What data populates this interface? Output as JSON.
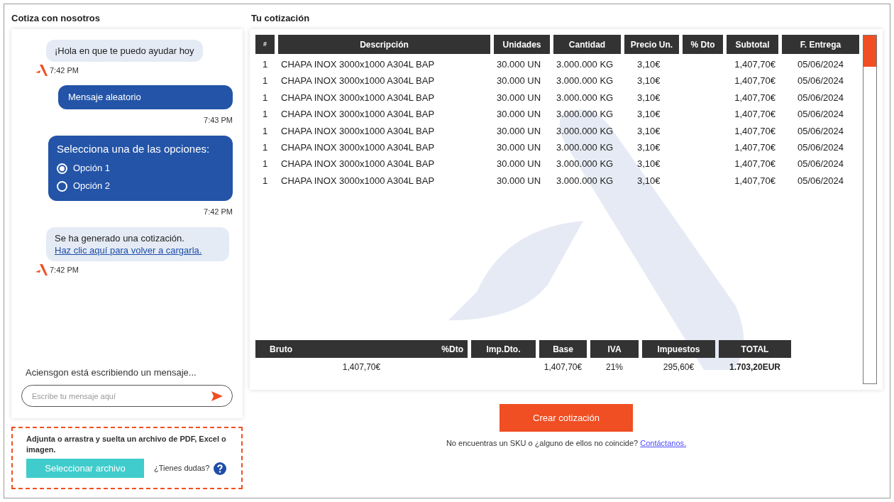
{
  "chat": {
    "title": "Cotiza con nosotros",
    "messages": [
      {
        "kind": "bot",
        "text": "¡Hola en que te puedo ayudar hoy",
        "time": "7:42 PM"
      },
      {
        "kind": "user",
        "text": "Mensaje aleatorio",
        "time": "7:43 PM"
      },
      {
        "kind": "options",
        "text": "Selecciona una de las opciones:",
        "time": "7:42 PM",
        "options": [
          {
            "label": "Opción 1",
            "selected": true
          },
          {
            "label": "Opción 2",
            "selected": false
          }
        ]
      },
      {
        "kind": "bot",
        "text": "Se ha generado una cotización.",
        "link": "Haz clic aquí para volver a cargarla.",
        "time": "7:42 PM"
      }
    ],
    "typing": "Aciensgon está escribiendo un mensaje...",
    "input": {
      "placeholder": "Escribe tu mensaje aquí"
    }
  },
  "upload": {
    "text": "Adjunta o arrastra y suelta un archivo de PDF, Excel  o imagen.",
    "button": "Seleccionar archivo",
    "help": "¿Tienes dudas?"
  },
  "quote": {
    "title": "Tu cotización",
    "columns": [
      "#",
      "Descripción",
      "Unidades",
      "Cantidad",
      "Precio Un.",
      "% Dto",
      "Subtotal",
      "F. Entrega"
    ],
    "rows": [
      {
        "num": "1",
        "description": "CHAPA INOX 3000x1000 A304L BAP",
        "units": "30.000 UN",
        "quantity": "3.000.000 KG",
        "price": "3,10€",
        "subtotal": "1,407,70€",
        "delivery": "05/06/2024"
      },
      {
        "num": "1",
        "description": "CHAPA INOX 3000x1000 A304L BAP",
        "units": "30.000 UN",
        "quantity": "3.000.000 KG",
        "price": "3,10€",
        "subtotal": "1,407,70€",
        "delivery": "05/06/2024"
      },
      {
        "num": "1",
        "description": "CHAPA INOX 3000x1000 A304L BAP",
        "units": "30.000 UN",
        "quantity": "3.000.000 KG",
        "price": "3,10€",
        "subtotal": "1,407,70€",
        "delivery": "05/06/2024"
      },
      {
        "num": "1",
        "description": "CHAPA INOX 3000x1000 A304L BAP",
        "units": "30.000 UN",
        "quantity": "3.000.000 KG",
        "price": "3,10€",
        "subtotal": "1,407,70€",
        "delivery": "05/06/2024"
      },
      {
        "num": "1",
        "description": "CHAPA INOX 3000x1000 A304L BAP",
        "units": "30.000 UN",
        "quantity": "3.000.000 KG",
        "price": "3,10€",
        "subtotal": "1,407,70€",
        "delivery": "05/06/2024"
      },
      {
        "num": "1",
        "description": "CHAPA INOX 3000x1000 A304L BAP",
        "units": "30.000 UN",
        "quantity": "3.000.000 KG",
        "price": "3,10€",
        "subtotal": "1,407,70€",
        "delivery": "05/06/2024"
      },
      {
        "num": "1",
        "description": "CHAPA INOX 3000x1000 A304L BAP",
        "units": "30.000 UN",
        "quantity": "3.000.000 KG",
        "price": "3,10€",
        "subtotal": "1,407,70€",
        "delivery": "05/06/2024"
      },
      {
        "num": "1",
        "description": "CHAPA INOX 3000x1000 A304L BAP",
        "units": "30.000 UN",
        "quantity": "3.000.000 KG",
        "price": "3,10€",
        "subtotal": "1,407,70€",
        "delivery": "05/06/2024"
      }
    ],
    "totals": {
      "columns": [
        "Bruto",
        "%Dto",
        "Imp.Dto.",
        "Base",
        "IVA",
        "Impuestos",
        "TOTAL"
      ],
      "values": {
        "bruto": "1,407,70€",
        "base": "1,407,70€",
        "iva": "21%",
        "impuestos": "295,60€",
        "total": "1.703,20EUR"
      }
    }
  },
  "create_button": "Crear cotización",
  "footer": {
    "text": "No encuentras un SKU o ¿alguno de ellos no coincide?",
    "link": "Contáctanos."
  }
}
